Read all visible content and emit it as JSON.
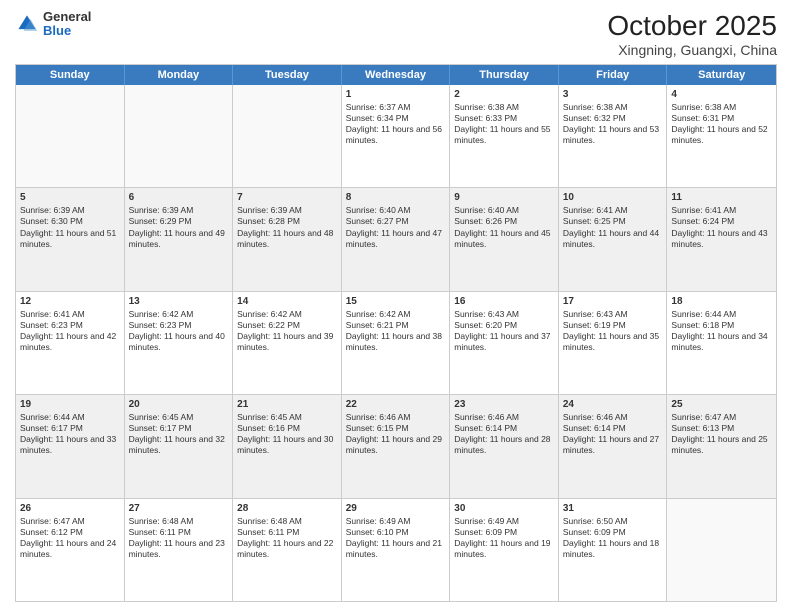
{
  "header": {
    "logo": {
      "general": "General",
      "blue": "Blue"
    },
    "month": "October 2025",
    "location": "Xingning, Guangxi, China"
  },
  "days": [
    "Sunday",
    "Monday",
    "Tuesday",
    "Wednesday",
    "Thursday",
    "Friday",
    "Saturday"
  ],
  "weeks": [
    [
      {
        "day": "",
        "sunrise": "",
        "sunset": "",
        "daylight": ""
      },
      {
        "day": "",
        "sunrise": "",
        "sunset": "",
        "daylight": ""
      },
      {
        "day": "",
        "sunrise": "",
        "sunset": "",
        "daylight": ""
      },
      {
        "day": "1",
        "sunrise": "Sunrise: 6:37 AM",
        "sunset": "Sunset: 6:34 PM",
        "daylight": "Daylight: 11 hours and 56 minutes."
      },
      {
        "day": "2",
        "sunrise": "Sunrise: 6:38 AM",
        "sunset": "Sunset: 6:33 PM",
        "daylight": "Daylight: 11 hours and 55 minutes."
      },
      {
        "day": "3",
        "sunrise": "Sunrise: 6:38 AM",
        "sunset": "Sunset: 6:32 PM",
        "daylight": "Daylight: 11 hours and 53 minutes."
      },
      {
        "day": "4",
        "sunrise": "Sunrise: 6:38 AM",
        "sunset": "Sunset: 6:31 PM",
        "daylight": "Daylight: 11 hours and 52 minutes."
      }
    ],
    [
      {
        "day": "5",
        "sunrise": "Sunrise: 6:39 AM",
        "sunset": "Sunset: 6:30 PM",
        "daylight": "Daylight: 11 hours and 51 minutes."
      },
      {
        "day": "6",
        "sunrise": "Sunrise: 6:39 AM",
        "sunset": "Sunset: 6:29 PM",
        "daylight": "Daylight: 11 hours and 49 minutes."
      },
      {
        "day": "7",
        "sunrise": "Sunrise: 6:39 AM",
        "sunset": "Sunset: 6:28 PM",
        "daylight": "Daylight: 11 hours and 48 minutes."
      },
      {
        "day": "8",
        "sunrise": "Sunrise: 6:40 AM",
        "sunset": "Sunset: 6:27 PM",
        "daylight": "Daylight: 11 hours and 47 minutes."
      },
      {
        "day": "9",
        "sunrise": "Sunrise: 6:40 AM",
        "sunset": "Sunset: 6:26 PM",
        "daylight": "Daylight: 11 hours and 45 minutes."
      },
      {
        "day": "10",
        "sunrise": "Sunrise: 6:41 AM",
        "sunset": "Sunset: 6:25 PM",
        "daylight": "Daylight: 11 hours and 44 minutes."
      },
      {
        "day": "11",
        "sunrise": "Sunrise: 6:41 AM",
        "sunset": "Sunset: 6:24 PM",
        "daylight": "Daylight: 11 hours and 43 minutes."
      }
    ],
    [
      {
        "day": "12",
        "sunrise": "Sunrise: 6:41 AM",
        "sunset": "Sunset: 6:23 PM",
        "daylight": "Daylight: 11 hours and 42 minutes."
      },
      {
        "day": "13",
        "sunrise": "Sunrise: 6:42 AM",
        "sunset": "Sunset: 6:23 PM",
        "daylight": "Daylight: 11 hours and 40 minutes."
      },
      {
        "day": "14",
        "sunrise": "Sunrise: 6:42 AM",
        "sunset": "Sunset: 6:22 PM",
        "daylight": "Daylight: 11 hours and 39 minutes."
      },
      {
        "day": "15",
        "sunrise": "Sunrise: 6:42 AM",
        "sunset": "Sunset: 6:21 PM",
        "daylight": "Daylight: 11 hours and 38 minutes."
      },
      {
        "day": "16",
        "sunrise": "Sunrise: 6:43 AM",
        "sunset": "Sunset: 6:20 PM",
        "daylight": "Daylight: 11 hours and 37 minutes."
      },
      {
        "day": "17",
        "sunrise": "Sunrise: 6:43 AM",
        "sunset": "Sunset: 6:19 PM",
        "daylight": "Daylight: 11 hours and 35 minutes."
      },
      {
        "day": "18",
        "sunrise": "Sunrise: 6:44 AM",
        "sunset": "Sunset: 6:18 PM",
        "daylight": "Daylight: 11 hours and 34 minutes."
      }
    ],
    [
      {
        "day": "19",
        "sunrise": "Sunrise: 6:44 AM",
        "sunset": "Sunset: 6:17 PM",
        "daylight": "Daylight: 11 hours and 33 minutes."
      },
      {
        "day": "20",
        "sunrise": "Sunrise: 6:45 AM",
        "sunset": "Sunset: 6:17 PM",
        "daylight": "Daylight: 11 hours and 32 minutes."
      },
      {
        "day": "21",
        "sunrise": "Sunrise: 6:45 AM",
        "sunset": "Sunset: 6:16 PM",
        "daylight": "Daylight: 11 hours and 30 minutes."
      },
      {
        "day": "22",
        "sunrise": "Sunrise: 6:46 AM",
        "sunset": "Sunset: 6:15 PM",
        "daylight": "Daylight: 11 hours and 29 minutes."
      },
      {
        "day": "23",
        "sunrise": "Sunrise: 6:46 AM",
        "sunset": "Sunset: 6:14 PM",
        "daylight": "Daylight: 11 hours and 28 minutes."
      },
      {
        "day": "24",
        "sunrise": "Sunrise: 6:46 AM",
        "sunset": "Sunset: 6:14 PM",
        "daylight": "Daylight: 11 hours and 27 minutes."
      },
      {
        "day": "25",
        "sunrise": "Sunrise: 6:47 AM",
        "sunset": "Sunset: 6:13 PM",
        "daylight": "Daylight: 11 hours and 25 minutes."
      }
    ],
    [
      {
        "day": "26",
        "sunrise": "Sunrise: 6:47 AM",
        "sunset": "Sunset: 6:12 PM",
        "daylight": "Daylight: 11 hours and 24 minutes."
      },
      {
        "day": "27",
        "sunrise": "Sunrise: 6:48 AM",
        "sunset": "Sunset: 6:11 PM",
        "daylight": "Daylight: 11 hours and 23 minutes."
      },
      {
        "day": "28",
        "sunrise": "Sunrise: 6:48 AM",
        "sunset": "Sunset: 6:11 PM",
        "daylight": "Daylight: 11 hours and 22 minutes."
      },
      {
        "day": "29",
        "sunrise": "Sunrise: 6:49 AM",
        "sunset": "Sunset: 6:10 PM",
        "daylight": "Daylight: 11 hours and 21 minutes."
      },
      {
        "day": "30",
        "sunrise": "Sunrise: 6:49 AM",
        "sunset": "Sunset: 6:09 PM",
        "daylight": "Daylight: 11 hours and 19 minutes."
      },
      {
        "day": "31",
        "sunrise": "Sunrise: 6:50 AM",
        "sunset": "Sunset: 6:09 PM",
        "daylight": "Daylight: 11 hours and 18 minutes."
      },
      {
        "day": "",
        "sunrise": "",
        "sunset": "",
        "daylight": ""
      }
    ]
  ]
}
